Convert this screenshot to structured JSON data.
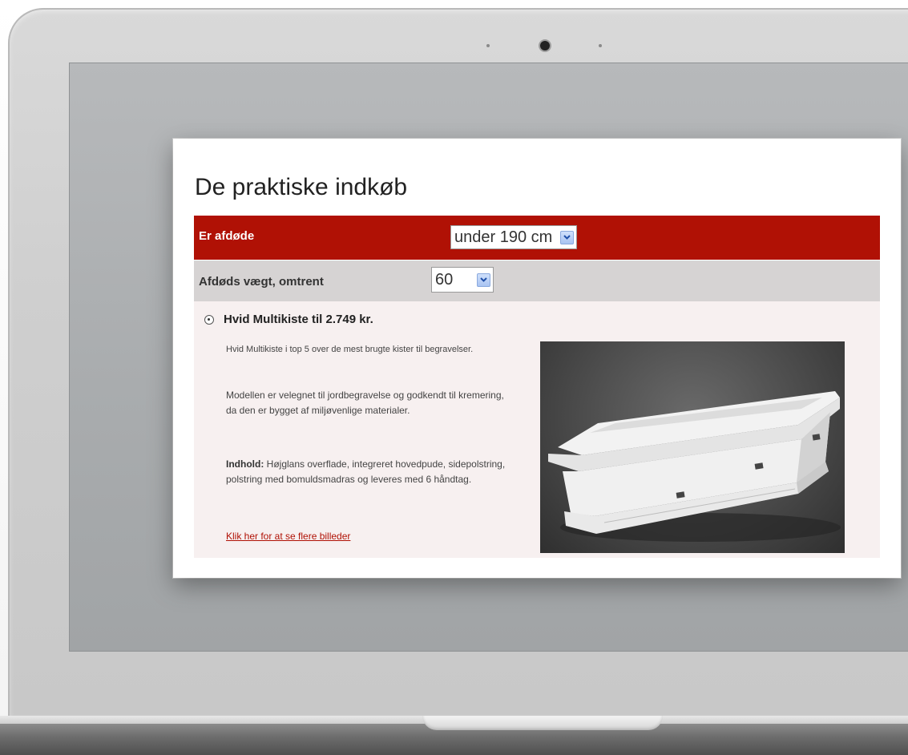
{
  "page": {
    "title": "De praktiske indkøb"
  },
  "form": {
    "height_label": "Er afdøde",
    "height_value": "under 190 cm",
    "weight_label": "Afdøds vægt, omtrent",
    "weight_value": "60"
  },
  "product": {
    "title": "Hvid Multikiste til 2.749 kr.",
    "desc_1": "Hvid Multikiste i top 5 over de mest brugte kister til begravelser.",
    "desc_2": "Modellen er velegnet til jordbegravelse og godkendt til kremering, da den er bygget af miljøvenlige materialer.",
    "contents_label": "Indhold:",
    "contents_text": "Højglans overflade, integreret hovedpude, sidepolstring, polstring med bomuldsmadras og leveres med 6 håndtag.",
    "link_text": "Klik her for at se flere billeder"
  },
  "colors": {
    "accent_red": "#b01105",
    "row_grey": "#d6d3d3",
    "content_bg": "#f7f0f0"
  },
  "icons": {
    "dropdown": "chevron-down-icon",
    "radio": "radio-selected-icon"
  }
}
